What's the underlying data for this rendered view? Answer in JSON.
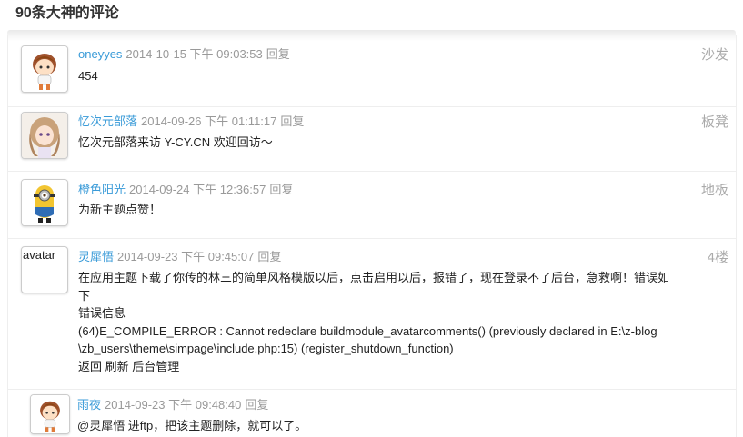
{
  "heading": "90条大神的评论",
  "comments": [
    {
      "author": "oneyyes",
      "time": "2014-10-15 下午 09:03:53",
      "reply": "回复",
      "floor": "沙发",
      "text": "454",
      "avatar_icon": "boy-avatar-icon"
    },
    {
      "author": "忆次元部落",
      "time": "2014-09-26 下午 01:11:17",
      "reply": "回复",
      "floor": "板凳",
      "text": "忆次元部落来访 Y-CY.CN 欢迎回访～",
      "avatar_icon": "anime-girl-avatar-icon"
    },
    {
      "author": "橙色阳光",
      "time": "2014-09-24 下午 12:36:57",
      "reply": "回复",
      "floor": "地板",
      "text": "为新主题点赞！",
      "avatar_icon": "minion-avatar-icon"
    },
    {
      "author": "灵犀悟",
      "time": "2014-09-23 下午 09:45:07",
      "reply": "回复",
      "floor": "4楼",
      "avatar_alt": "avatar",
      "text_lines": [
        "在应用主题下载了你传的林三的简单风格模版以后，点击启用以后，报错了，现在登录不了后台，急救啊！错误如",
        "下",
        "错误信息",
        "(64)E_COMPILE_ERROR : Cannot redeclare buildmodule_avatarcomments() (previously declared in E:\\z-blog",
        "\\zb_users\\theme\\simpage\\include.php:15) (register_shutdown_function)",
        "返回 刷新 后台管理"
      ]
    }
  ],
  "reply_comment": {
    "author": "雨夜",
    "time": "2014-09-23 下午 09:48:40",
    "reply": "回复",
    "text": "@灵犀悟 进ftp，把该主题删除，就可以了。",
    "avatar_icon": "boy-avatar-icon"
  },
  "colors": {
    "author": "#3a9bd8",
    "meta": "#999999",
    "floor": "#aaaaaa",
    "text": "#222222"
  }
}
